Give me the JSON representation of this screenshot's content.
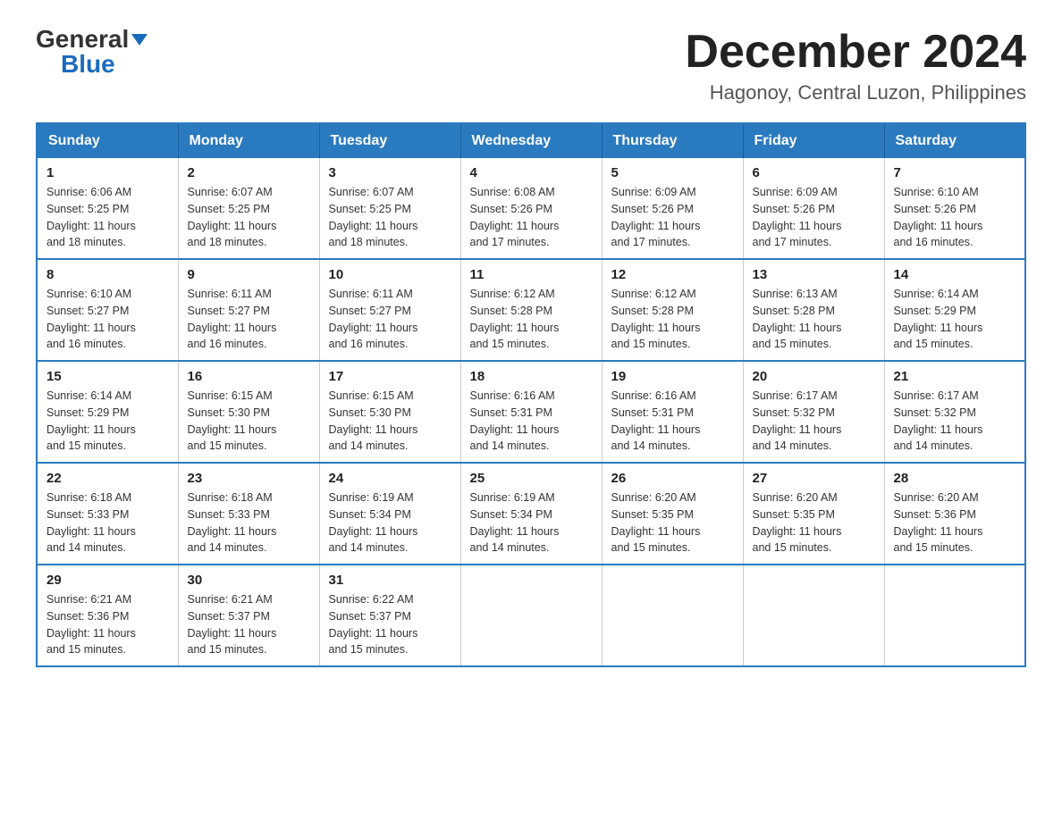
{
  "logo": {
    "general": "General",
    "blue": "Blue",
    "triangle": "▼"
  },
  "title": "December 2024",
  "location": "Hagonoy, Central Luzon, Philippines",
  "days_of_week": [
    "Sunday",
    "Monday",
    "Tuesday",
    "Wednesday",
    "Thursday",
    "Friday",
    "Saturday"
  ],
  "weeks": [
    [
      {
        "day": "1",
        "sunrise": "6:06 AM",
        "sunset": "5:25 PM",
        "daylight": "11 hours and 18 minutes."
      },
      {
        "day": "2",
        "sunrise": "6:07 AM",
        "sunset": "5:25 PM",
        "daylight": "11 hours and 18 minutes."
      },
      {
        "day": "3",
        "sunrise": "6:07 AM",
        "sunset": "5:25 PM",
        "daylight": "11 hours and 18 minutes."
      },
      {
        "day": "4",
        "sunrise": "6:08 AM",
        "sunset": "5:26 PM",
        "daylight": "11 hours and 17 minutes."
      },
      {
        "day": "5",
        "sunrise": "6:09 AM",
        "sunset": "5:26 PM",
        "daylight": "11 hours and 17 minutes."
      },
      {
        "day": "6",
        "sunrise": "6:09 AM",
        "sunset": "5:26 PM",
        "daylight": "11 hours and 17 minutes."
      },
      {
        "day": "7",
        "sunrise": "6:10 AM",
        "sunset": "5:26 PM",
        "daylight": "11 hours and 16 minutes."
      }
    ],
    [
      {
        "day": "8",
        "sunrise": "6:10 AM",
        "sunset": "5:27 PM",
        "daylight": "11 hours and 16 minutes."
      },
      {
        "day": "9",
        "sunrise": "6:11 AM",
        "sunset": "5:27 PM",
        "daylight": "11 hours and 16 minutes."
      },
      {
        "day": "10",
        "sunrise": "6:11 AM",
        "sunset": "5:27 PM",
        "daylight": "11 hours and 16 minutes."
      },
      {
        "day": "11",
        "sunrise": "6:12 AM",
        "sunset": "5:28 PM",
        "daylight": "11 hours and 15 minutes."
      },
      {
        "day": "12",
        "sunrise": "6:12 AM",
        "sunset": "5:28 PM",
        "daylight": "11 hours and 15 minutes."
      },
      {
        "day": "13",
        "sunrise": "6:13 AM",
        "sunset": "5:28 PM",
        "daylight": "11 hours and 15 minutes."
      },
      {
        "day": "14",
        "sunrise": "6:14 AM",
        "sunset": "5:29 PM",
        "daylight": "11 hours and 15 minutes."
      }
    ],
    [
      {
        "day": "15",
        "sunrise": "6:14 AM",
        "sunset": "5:29 PM",
        "daylight": "11 hours and 15 minutes."
      },
      {
        "day": "16",
        "sunrise": "6:15 AM",
        "sunset": "5:30 PM",
        "daylight": "11 hours and 15 minutes."
      },
      {
        "day": "17",
        "sunrise": "6:15 AM",
        "sunset": "5:30 PM",
        "daylight": "11 hours and 14 minutes."
      },
      {
        "day": "18",
        "sunrise": "6:16 AM",
        "sunset": "5:31 PM",
        "daylight": "11 hours and 14 minutes."
      },
      {
        "day": "19",
        "sunrise": "6:16 AM",
        "sunset": "5:31 PM",
        "daylight": "11 hours and 14 minutes."
      },
      {
        "day": "20",
        "sunrise": "6:17 AM",
        "sunset": "5:32 PM",
        "daylight": "11 hours and 14 minutes."
      },
      {
        "day": "21",
        "sunrise": "6:17 AM",
        "sunset": "5:32 PM",
        "daylight": "11 hours and 14 minutes."
      }
    ],
    [
      {
        "day": "22",
        "sunrise": "6:18 AM",
        "sunset": "5:33 PM",
        "daylight": "11 hours and 14 minutes."
      },
      {
        "day": "23",
        "sunrise": "6:18 AM",
        "sunset": "5:33 PM",
        "daylight": "11 hours and 14 minutes."
      },
      {
        "day": "24",
        "sunrise": "6:19 AM",
        "sunset": "5:34 PM",
        "daylight": "11 hours and 14 minutes."
      },
      {
        "day": "25",
        "sunrise": "6:19 AM",
        "sunset": "5:34 PM",
        "daylight": "11 hours and 14 minutes."
      },
      {
        "day": "26",
        "sunrise": "6:20 AM",
        "sunset": "5:35 PM",
        "daylight": "11 hours and 15 minutes."
      },
      {
        "day": "27",
        "sunrise": "6:20 AM",
        "sunset": "5:35 PM",
        "daylight": "11 hours and 15 minutes."
      },
      {
        "day": "28",
        "sunrise": "6:20 AM",
        "sunset": "5:36 PM",
        "daylight": "11 hours and 15 minutes."
      }
    ],
    [
      {
        "day": "29",
        "sunrise": "6:21 AM",
        "sunset": "5:36 PM",
        "daylight": "11 hours and 15 minutes."
      },
      {
        "day": "30",
        "sunrise": "6:21 AM",
        "sunset": "5:37 PM",
        "daylight": "11 hours and 15 minutes."
      },
      {
        "day": "31",
        "sunrise": "6:22 AM",
        "sunset": "5:37 PM",
        "daylight": "11 hours and 15 minutes."
      },
      null,
      null,
      null,
      null
    ]
  ],
  "labels": {
    "sunrise": "Sunrise:",
    "sunset": "Sunset:",
    "daylight": "Daylight:"
  }
}
